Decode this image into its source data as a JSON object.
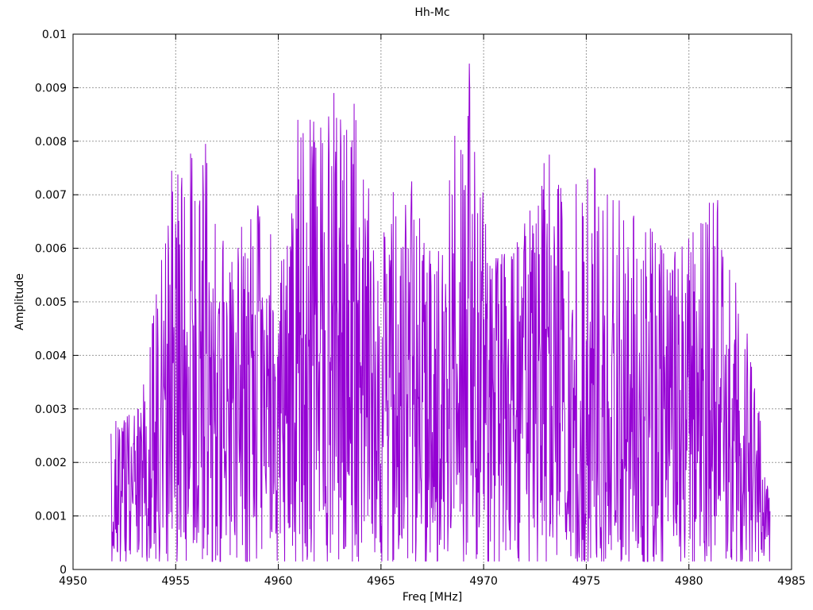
{
  "chart_data": {
    "type": "line",
    "title": "Hh-Mc",
    "xlabel": "Freq [MHz]",
    "ylabel": "Amplitude",
    "xlim": [
      4950,
      4985
    ],
    "ylim": [
      0,
      0.01
    ],
    "x_ticks": [
      4950,
      4955,
      4960,
      4965,
      4970,
      4975,
      4980,
      4985
    ],
    "x_tick_labels": [
      "4950",
      "4955",
      "4960",
      "4965",
      "4970",
      "4975",
      "4980",
      "4985"
    ],
    "y_ticks": [
      0,
      0.001,
      0.002,
      0.003,
      0.004,
      0.005,
      0.006,
      0.007,
      0.008,
      0.009,
      0.01
    ],
    "y_tick_labels": [
      "0",
      "0.001",
      "0.002",
      "0.003",
      "0.004",
      "0.005",
      "0.006",
      "0.007",
      "0.008",
      "0.009",
      "0.01"
    ],
    "grid": true,
    "legend": "none",
    "line_color": "#9400d3",
    "grid_color": "#9b9b9b",
    "border_color": "#000000",
    "background": "#ffffff",
    "series": [
      {
        "name": "Hh-Mc",
        "style": "lines",
        "x_start": 4951.85,
        "x_end": 4983.95,
        "n_points": 1500,
        "seed": 20240509,
        "noise_floor": 0.00015,
        "envelope_keypoints": [
          [
            4951.85,
            0.0013,
            0.0028
          ],
          [
            4953.2,
            0.0016,
            0.003
          ],
          [
            4954.2,
            0.0028,
            0.0055
          ],
          [
            4954.9,
            0.0033,
            0.0075
          ],
          [
            4956.4,
            0.0033,
            0.008
          ],
          [
            4957.5,
            0.003,
            0.006
          ],
          [
            4959.0,
            0.0032,
            0.0068
          ],
          [
            4960.3,
            0.003,
            0.0058
          ],
          [
            4961.0,
            0.0034,
            0.0084
          ],
          [
            4962.7,
            0.0034,
            0.0089
          ],
          [
            4963.8,
            0.0034,
            0.0087
          ],
          [
            4965.0,
            0.0029,
            0.0062
          ],
          [
            4966.5,
            0.0031,
            0.0072
          ],
          [
            4967.5,
            0.0028,
            0.0058
          ],
          [
            4968.7,
            0.0032,
            0.0081
          ],
          [
            4969.35,
            0.0033,
            0.0095
          ],
          [
            4970.3,
            0.003,
            0.0058
          ],
          [
            4971.5,
            0.0031,
            0.006
          ],
          [
            4973.0,
            0.0034,
            0.0077
          ],
          [
            4974.2,
            0.0032,
            0.0068
          ],
          [
            4975.4,
            0.0034,
            0.0075
          ],
          [
            4976.5,
            0.0031,
            0.007
          ],
          [
            4977.8,
            0.003,
            0.0066
          ],
          [
            4979.0,
            0.0029,
            0.0058
          ],
          [
            4980.2,
            0.003,
            0.0063
          ],
          [
            4981.2,
            0.0032,
            0.0069
          ],
          [
            4982.2,
            0.0028,
            0.006
          ],
          [
            4983.0,
            0.0022,
            0.004
          ],
          [
            4983.5,
            0.0015,
            0.0028
          ],
          [
            4983.95,
            0.0007,
            0.0012
          ]
        ],
        "peaks": [
          [
            4954.8,
            0.00745
          ],
          [
            4955.05,
            0.0062
          ],
          [
            4956.45,
            0.00795
          ],
          [
            4958.2,
            0.0064
          ],
          [
            4959.0,
            0.0068
          ],
          [
            4960.95,
            0.0084
          ],
          [
            4961.7,
            0.00755
          ],
          [
            4962.7,
            0.0089
          ],
          [
            4963.05,
            0.0079
          ],
          [
            4963.7,
            0.0087
          ],
          [
            4965.6,
            0.00705
          ],
          [
            4966.5,
            0.00725
          ],
          [
            4968.6,
            0.0081
          ],
          [
            4969.3,
            0.00945
          ],
          [
            4969.55,
            0.0078
          ],
          [
            4971.0,
            0.0058
          ],
          [
            4972.9,
            0.0071
          ],
          [
            4973.2,
            0.00775
          ],
          [
            4974.5,
            0.0072
          ],
          [
            4974.8,
            0.00685
          ],
          [
            4975.4,
            0.0075
          ],
          [
            4976.3,
            0.0069
          ],
          [
            4977.3,
            0.00655
          ],
          [
            4977.9,
            0.0063
          ],
          [
            4979.3,
            0.0058
          ],
          [
            4980.2,
            0.0063
          ],
          [
            4981.0,
            0.00685
          ],
          [
            4981.4,
            0.0069
          ]
        ]
      }
    ]
  }
}
